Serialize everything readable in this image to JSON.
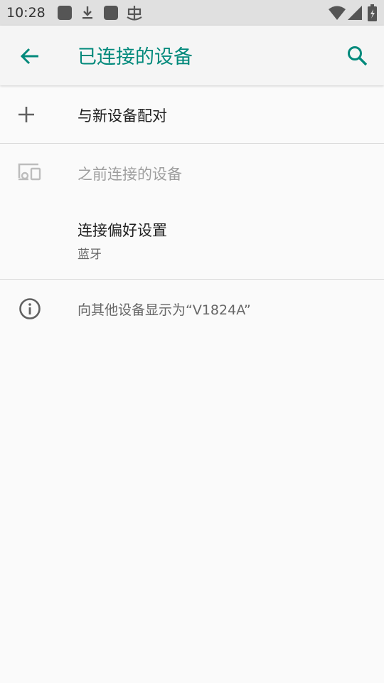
{
  "status_bar": {
    "time": "10:28",
    "icons": [
      "app-icon",
      "download-icon",
      "app-icon",
      "bug-icon",
      "wifi-icon",
      "signal-icon",
      "battery-icon"
    ]
  },
  "app_bar": {
    "title": "已连接的设备",
    "back_icon": "arrow-back-icon",
    "search_icon": "search-icon",
    "accent_color": "#00897b"
  },
  "items": {
    "pair_new": {
      "label": "与新设备配对",
      "icon": "plus-icon"
    },
    "previous_devices": {
      "label": "之前连接的设备",
      "icon": "devices-icon"
    },
    "connection_prefs": {
      "label": "连接偏好设置",
      "summary": "蓝牙"
    },
    "visible_as": {
      "label": "向其他设备显示为“V1824A”",
      "icon": "info-icon"
    }
  }
}
